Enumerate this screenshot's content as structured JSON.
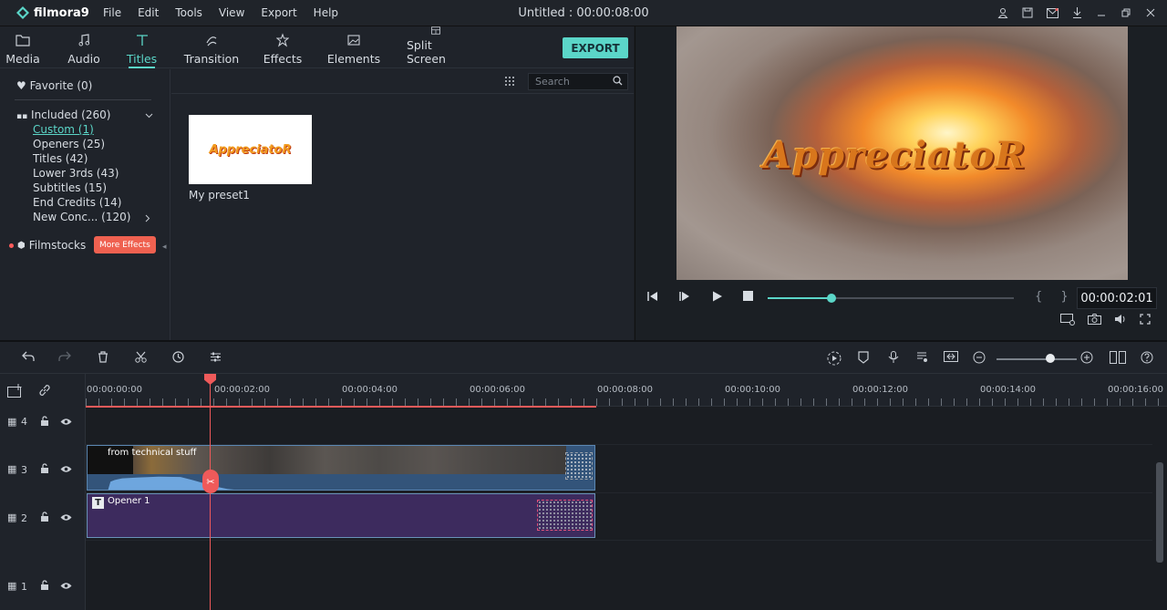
{
  "app": {
    "logo_text": "filmora9",
    "window_title": "Untitled : 00:00:08:00",
    "menu": [
      "File",
      "Edit",
      "Tools",
      "View",
      "Export",
      "Help"
    ],
    "title_icons": [
      "user-icon",
      "save-icon",
      "mail-icon",
      "download-icon",
      "minimize-icon",
      "restore-icon",
      "close-icon"
    ]
  },
  "tabs": [
    {
      "label": "Media",
      "icon": "folder-icon"
    },
    {
      "label": "Audio",
      "icon": "music-note-icon"
    },
    {
      "label": "Titles",
      "icon": "text-icon"
    },
    {
      "label": "Transition",
      "icon": "transition-icon"
    },
    {
      "label": "Effects",
      "icon": "effects-icon"
    },
    {
      "label": "Elements",
      "icon": "image-icon"
    },
    {
      "label": "Split Screen",
      "icon": "split-screen-icon"
    }
  ],
  "active_tab": "Titles",
  "export_label": "EXPORT",
  "categories": {
    "favorite": "Favorite (0)",
    "included": "Included (260)",
    "items": [
      "Custom (1)",
      "Openers (25)",
      "Titles (42)",
      "Lower 3rds (43)",
      "Subtitles (15)",
      "End Credits (14)",
      "New Conc... (120)"
    ],
    "active_item": "Custom (1)",
    "filmstocks": "Filmstocks",
    "more_effects": "More Effects"
  },
  "search": {
    "placeholder": "Search"
  },
  "presets": [
    {
      "label": "My preset1",
      "thumb_text": "AppreciatoR"
    }
  ],
  "preview": {
    "overlay_text": "AppreciatoR",
    "timecode": "00:00:02:01",
    "progress": 0.26,
    "brackets": "{ }"
  },
  "ruler_labels": [
    "00:00:00:00",
    "00:00:02:00",
    "00:00:04:00",
    "00:00:06:00",
    "00:00:08:00",
    "00:00:10:00",
    "00:00:12:00",
    "00:00:14:00",
    "00:00:16:00"
  ],
  "tracks": [
    {
      "number": "4"
    },
    {
      "number": "3"
    },
    {
      "number": "2"
    },
    {
      "number": "1"
    }
  ],
  "clips": {
    "video_name": "from technical stuff",
    "title_name": "Opener 1",
    "title_badge": "T"
  },
  "colors": {
    "accent": "#5bd6c8",
    "playhead": "#ef5a5a",
    "title_clip": "#3d2b5e",
    "video_clip": "#33547a"
  }
}
